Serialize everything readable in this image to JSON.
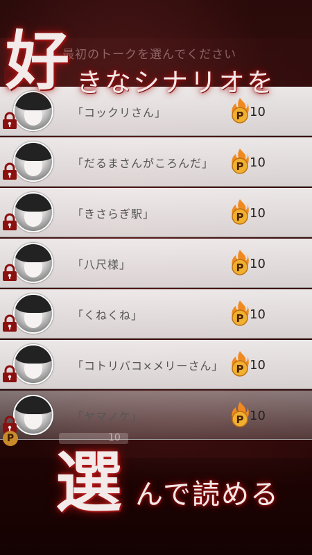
{
  "header": {
    "ghost_title": "最初のトークを選んでください",
    "headline_big": "好",
    "headline_rest": "きなシナリオを"
  },
  "scenarios": [
    {
      "label": "「コックリさん」",
      "cost": "10"
    },
    {
      "label": "「だるまさんがころんだ」",
      "cost": "10"
    },
    {
      "label": "「きさらぎ駅」",
      "cost": "10"
    },
    {
      "label": "「八尺様」",
      "cost": "10"
    },
    {
      "label": "「くねくね」",
      "cost": "10"
    },
    {
      "label": "「コトリバコ×メリーさん」",
      "cost": "10"
    },
    {
      "label": "「ヤマノケ」",
      "cost": "10"
    }
  ],
  "ghost_bottom": {
    "coin_letter": "P",
    "value": "10"
  },
  "footer": {
    "headline_big": "選",
    "headline_rest": "んで読める"
  },
  "colors": {
    "accent": "#c02020",
    "coin": "#e8a030",
    "lock": "#8a1010"
  },
  "icons": {
    "lock": "lock-icon",
    "coin": "p-coin-flame-icon"
  }
}
